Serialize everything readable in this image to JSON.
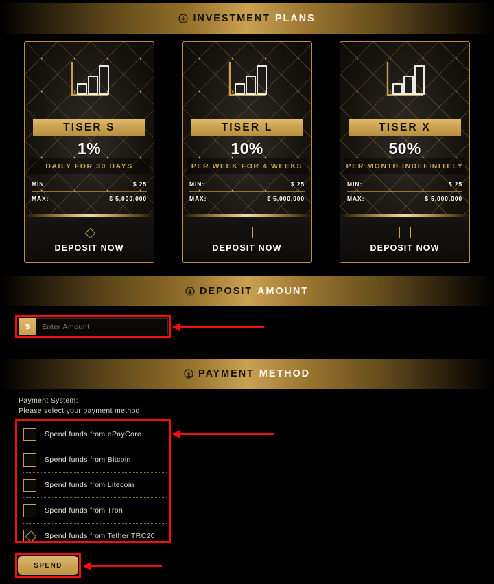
{
  "sections": {
    "plans": {
      "icon": "download-circle-icon",
      "title_dark": "INVESTMENT",
      "title_light": "PLANS"
    },
    "amount": {
      "icon": "download-circle-icon",
      "title_dark": "DEPOSIT",
      "title_light": "AMOUNT"
    },
    "method": {
      "icon": "download-circle-icon",
      "title_dark": "PAYMENT",
      "title_light": "METHOD"
    }
  },
  "plans": [
    {
      "name": "TISER S",
      "rate": "1%",
      "term": "DAILY FOR 30 DAYS",
      "min_label": "MIN:",
      "min_value": "$ 25",
      "max_label": "MAX:",
      "max_value": "$ 5,000,000",
      "deposit_label": "DEPOSIT NOW",
      "deposit_icon": "diamond-in-square-icon",
      "chart_icon": "bar-chart-icon"
    },
    {
      "name": "TISER L",
      "rate": "10%",
      "term": "PER WEEK FOR 4 WEEKS",
      "min_label": "MIN:",
      "min_value": "$ 25",
      "max_label": "MAX:",
      "max_value": "$ 5,000,000",
      "deposit_label": "DEPOSIT NOW",
      "deposit_icon": "square-icon",
      "chart_icon": "bar-chart-icon"
    },
    {
      "name": "TISER X",
      "rate": "50%",
      "term": "PER MONTH INDEFINITELY",
      "min_label": "MIN:",
      "min_value": "$ 25",
      "max_label": "MAX:",
      "max_value": "$ 5,000,000",
      "deposit_label": "DEPOSIT NOW",
      "deposit_icon": "square-icon",
      "chart_icon": "bar-chart-icon"
    }
  ],
  "amount_form": {
    "currency_symbol": "$",
    "placeholder": "Enter Amount",
    "value": ""
  },
  "payment": {
    "note_line1": "Payment System:",
    "note_line2": "Please select your payment method.",
    "options": [
      {
        "label": "Spend funds from ePayCore",
        "checked": false
      },
      {
        "label": "Spend funds from Bitcoin",
        "checked": false
      },
      {
        "label": "Spend funds from Litecoin",
        "checked": false
      },
      {
        "label": "Spend funds from Tron",
        "checked": false
      },
      {
        "label": "Spend funds from Tether TRC20",
        "checked": true
      }
    ],
    "submit_label": "SPEND"
  },
  "colors": {
    "gold": "#c79f4e",
    "gold_light": "#dcba72",
    "background": "#000000",
    "annotation_red": "#f60d0d",
    "text_light": "#ffffff"
  }
}
